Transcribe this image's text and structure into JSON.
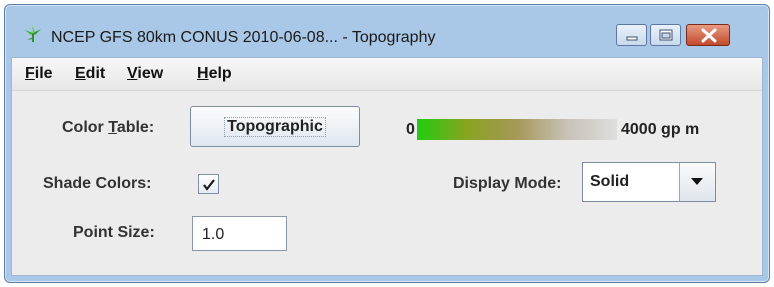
{
  "window": {
    "title": "NCEP GFS 80km CONUS 2010-06-08... - Topography",
    "app_icon": "plant-icon",
    "controls": [
      "minimize-icon",
      "maximize-icon",
      "close-icon"
    ]
  },
  "menubar": {
    "items": [
      {
        "label_mn": "F",
        "label_rest": "ile"
      },
      {
        "label_mn": "E",
        "label_rest": "dit"
      },
      {
        "label_mn": "V",
        "label_rest": "iew"
      },
      {
        "label_mn": "H",
        "label_rest": "elp"
      }
    ]
  },
  "form": {
    "color_table": {
      "label_a": "Color ",
      "label_mn": "T",
      "label_b": "able:",
      "button_label": "Topographic",
      "range_min": "0",
      "range_max": "4000 gp m",
      "gradient_colors": [
        "#22cc11",
        "#8aa320",
        "#a59858",
        "#c8c2b8",
        "#dedede"
      ]
    },
    "shade_colors": {
      "label": "Shade Colors:",
      "checked": true
    },
    "display_mode": {
      "label": "Display Mode:",
      "value": "Solid"
    },
    "point_size": {
      "label": "Point Size:",
      "value": "1.0"
    }
  },
  "colors": {
    "frame": "#a9c7e6",
    "panel": "#ececec",
    "close_button": "#c24a2c"
  }
}
